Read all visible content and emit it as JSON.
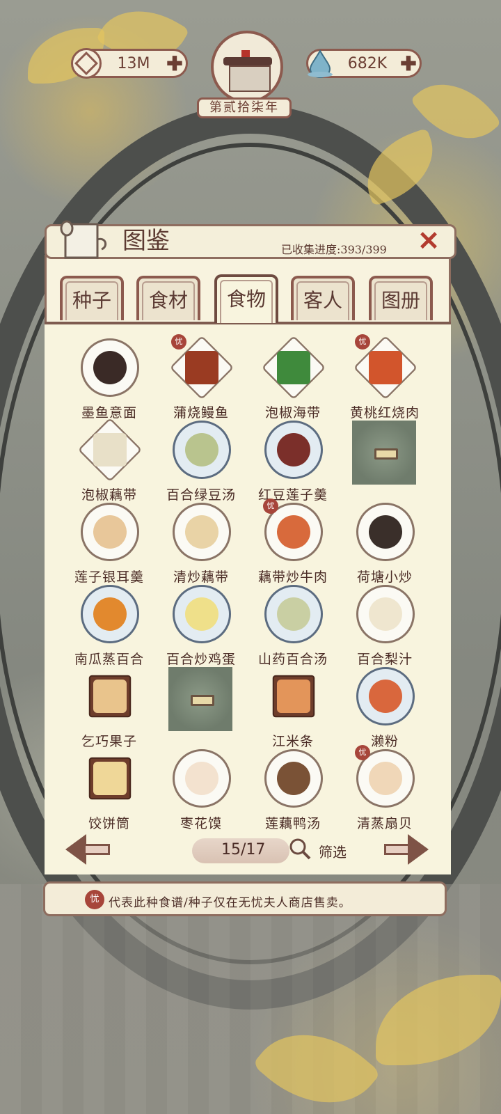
{
  "resources": {
    "coins": "13M",
    "water": "682K",
    "plus": "✚"
  },
  "year_label": "第贰拾柒年",
  "panel": {
    "title": "图鉴",
    "progress": "已收集进度:393/399",
    "close": "✕"
  },
  "tabs": [
    {
      "label": "种子"
    },
    {
      "label": "食材"
    },
    {
      "label": "食物",
      "active": true
    },
    {
      "label": "客人"
    },
    {
      "label": "图册"
    }
  ],
  "dishes": [
    {
      "name": "墨鱼意面",
      "shop": false,
      "plate": "round",
      "color": "#3a2a26"
    },
    {
      "name": "蒲烧鳗鱼",
      "shop": true,
      "plate": "square",
      "color": "#9a3b22"
    },
    {
      "name": "泡椒海带",
      "shop": false,
      "plate": "square",
      "color": "#3f8a3c"
    },
    {
      "name": "黄桃红烧肉",
      "shop": true,
      "plate": "square",
      "color": "#d2552c"
    },
    {
      "name": "泡椒藕带",
      "shop": false,
      "plate": "square",
      "color": "#e8e0c8"
    },
    {
      "name": "百合绿豆汤",
      "shop": false,
      "plate": "bowl",
      "color": "#b9c48e"
    },
    {
      "name": "红豆莲子羹",
      "shop": false,
      "plate": "bowl",
      "color": "#7b2f2a"
    },
    {
      "name": "",
      "locked": true
    },
    {
      "name": "莲子银耳羹",
      "shop": false,
      "plate": "round",
      "color": "#e8c79a"
    },
    {
      "name": "清炒藕带",
      "shop": false,
      "plate": "round",
      "color": "#e9d3a6"
    },
    {
      "name": "藕带炒牛肉",
      "shop": true,
      "plate": "round",
      "color": "#d86a3c"
    },
    {
      "name": "荷塘小炒",
      "shop": false,
      "plate": "round",
      "color": "#3a2f2a"
    },
    {
      "name": "南瓜蒸百合",
      "shop": false,
      "plate": "bowl",
      "color": "#e2892e"
    },
    {
      "name": "百合炒鸡蛋",
      "shop": false,
      "plate": "bowl",
      "color": "#efe08a"
    },
    {
      "name": "山药百合汤",
      "shop": false,
      "plate": "bowl",
      "color": "#c9cfa3"
    },
    {
      "name": "百合梨汁",
      "shop": false,
      "plate": "round",
      "color": "#efe6cf"
    },
    {
      "name": "乞巧果子",
      "shop": false,
      "plate": "box",
      "color": "#e9c48c"
    },
    {
      "name": "",
      "locked": true
    },
    {
      "name": "江米条",
      "shop": false,
      "plate": "box",
      "color": "#e3955a"
    },
    {
      "name": "濑粉",
      "shop": false,
      "plate": "bowl",
      "color": "#d9673d"
    },
    {
      "name": "饺饼筒",
      "shop": false,
      "plate": "box",
      "color": "#efd798"
    },
    {
      "name": "枣花馍",
      "shop": false,
      "plate": "round",
      "color": "#f3e2cf"
    },
    {
      "name": "莲藕鸭汤",
      "shop": false,
      "plate": "round",
      "color": "#7a5236"
    },
    {
      "name": "清蒸扇贝",
      "shop": true,
      "plate": "round",
      "color": "#f0d7b8"
    }
  ],
  "shop_badge": "忧",
  "pager": {
    "page": "15/17",
    "filter": "筛选"
  },
  "note": {
    "badge": "忧",
    "text": "代表此种食谱/种子仅在无忧夫人商店售卖。"
  },
  "colors": {
    "accent_red": "#a7453a",
    "border_brown": "#8c5a4e",
    "paper": "#f8f4de"
  }
}
